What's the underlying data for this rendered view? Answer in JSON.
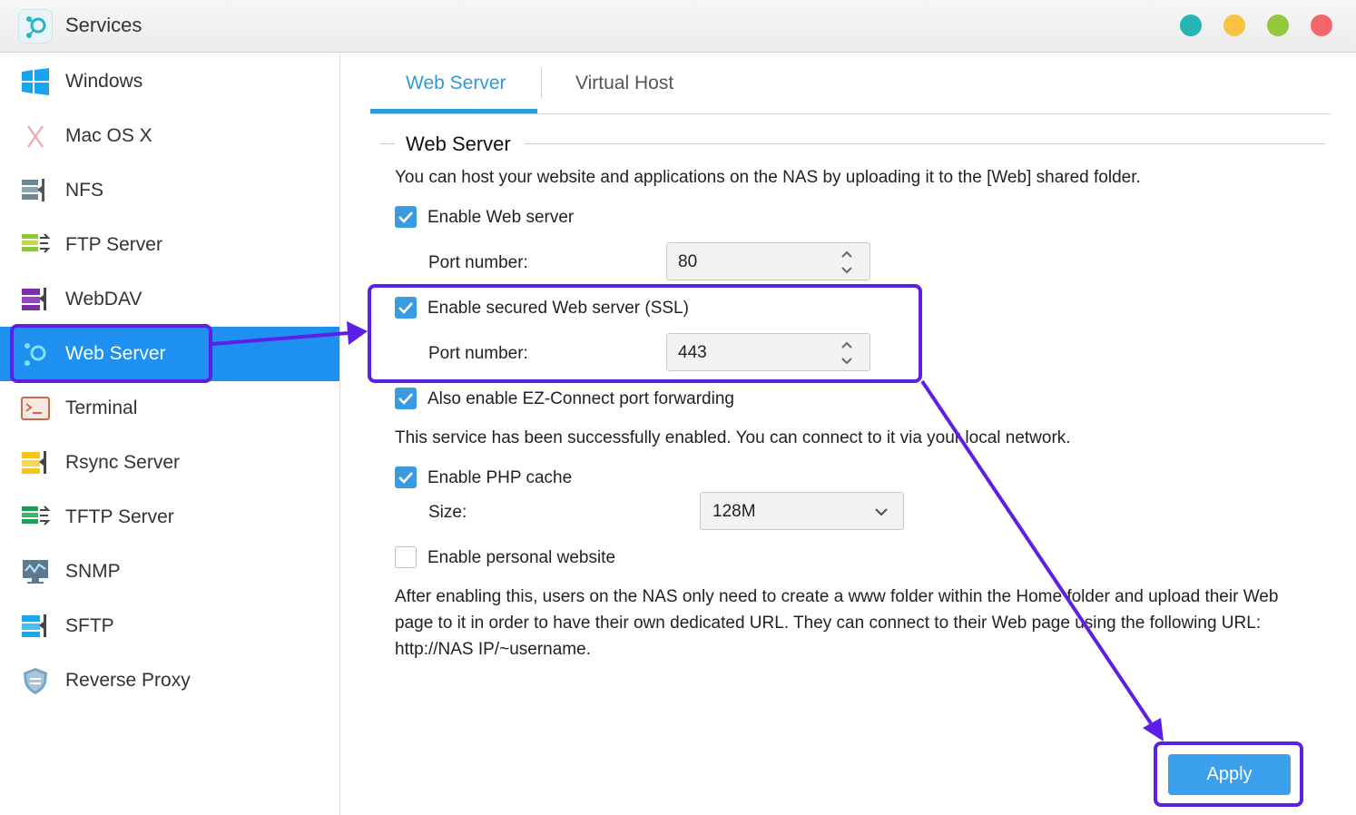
{
  "window": {
    "title": "Services"
  },
  "sidebar": {
    "items": [
      {
        "label": "Windows",
        "icon": "windows-icon"
      },
      {
        "label": "Mac OS X",
        "icon": "macos-icon"
      },
      {
        "label": "NFS",
        "icon": "nfs-icon"
      },
      {
        "label": "FTP Server",
        "icon": "ftp-icon"
      },
      {
        "label": "WebDAV",
        "icon": "webdav-icon"
      },
      {
        "label": "Web Server",
        "icon": "web-server-icon",
        "active": true
      },
      {
        "label": "Terminal",
        "icon": "terminal-icon"
      },
      {
        "label": "Rsync Server",
        "icon": "rsync-icon"
      },
      {
        "label": "TFTP Server",
        "icon": "tftp-icon"
      },
      {
        "label": "SNMP",
        "icon": "snmp-icon"
      },
      {
        "label": "SFTP",
        "icon": "sftp-icon"
      },
      {
        "label": "Reverse Proxy",
        "icon": "reverse-proxy-icon"
      }
    ]
  },
  "tabs": [
    {
      "label": "Web Server",
      "active": true
    },
    {
      "label": "Virtual Host",
      "active": false
    }
  ],
  "section": {
    "title": "Web Server",
    "description": "You can host your website and applications on the NAS by uploading it to the [Web] shared folder."
  },
  "web_server": {
    "label": "Enable Web server",
    "checked": true,
    "port_label": "Port number:",
    "port": "80"
  },
  "ssl": {
    "label": "Enable secured Web server (SSL)",
    "checked": true,
    "port_label": "Port number:",
    "port": "443"
  },
  "ez_connect": {
    "label": "Also enable EZ-Connect port forwarding",
    "checked": true
  },
  "status_text": "This service has been successfully enabled. You can connect to it via your local network.",
  "php_cache": {
    "label": "Enable PHP cache",
    "checked": true,
    "size_label": "Size:",
    "size": "128M"
  },
  "personal_website": {
    "label": "Enable personal website",
    "checked": false,
    "note_line1": "After enabling this, users on the NAS only need to create a www folder within the Home folder and upload their Web",
    "note_line2": "page to it in order to have their own dedicated URL. They can connect to their Web page using the following URL:",
    "note_line3": "http://NAS IP/~username."
  },
  "apply_button": "Apply",
  "colors": {
    "accent": "#1e90ef",
    "tab_accent": "#2d9ad8",
    "checkbox": "#3a9be0",
    "apply": "#3aa0ec",
    "annotation": "#5b1fe6",
    "window_dots": [
      "#26b5b5",
      "#f6c343",
      "#93c83d",
      "#f1676c"
    ]
  }
}
